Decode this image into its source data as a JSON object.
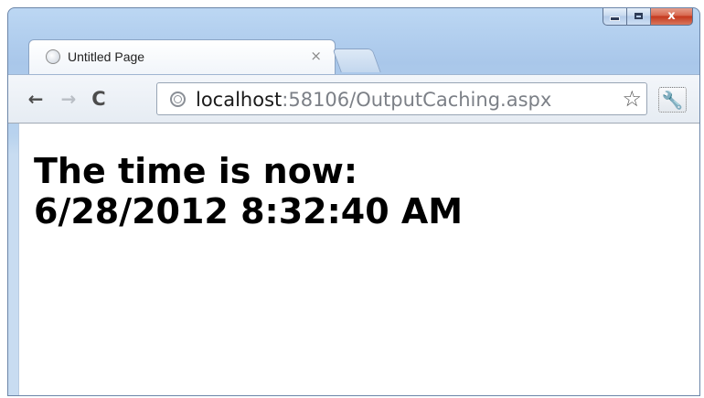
{
  "window": {
    "caption": {
      "minimize_label": "",
      "maximize_label": "",
      "close_label": "x"
    }
  },
  "tabs": [
    {
      "title": "Untitled Page",
      "close_glyph": "×",
      "favicon": "globe-icon",
      "active": true
    }
  ],
  "toolbar": {
    "back_glyph": "←",
    "forward_glyph": "→",
    "reload_glyph": "C",
    "address": {
      "host": "localhost",
      "rest": ":58106/OutputCaching.aspx",
      "page_icon": "globe-icon"
    },
    "bookmark_glyph": "☆",
    "wrench_glyph": "🔧"
  },
  "page": {
    "line1": "The time is now:",
    "line2": "6/28/2012 8:32:40 AM"
  },
  "colors": {
    "frame": "#a9c7ea",
    "close_button": "#c4361c",
    "url_host": "#1a1a1a",
    "url_rest": "#7c8087"
  }
}
